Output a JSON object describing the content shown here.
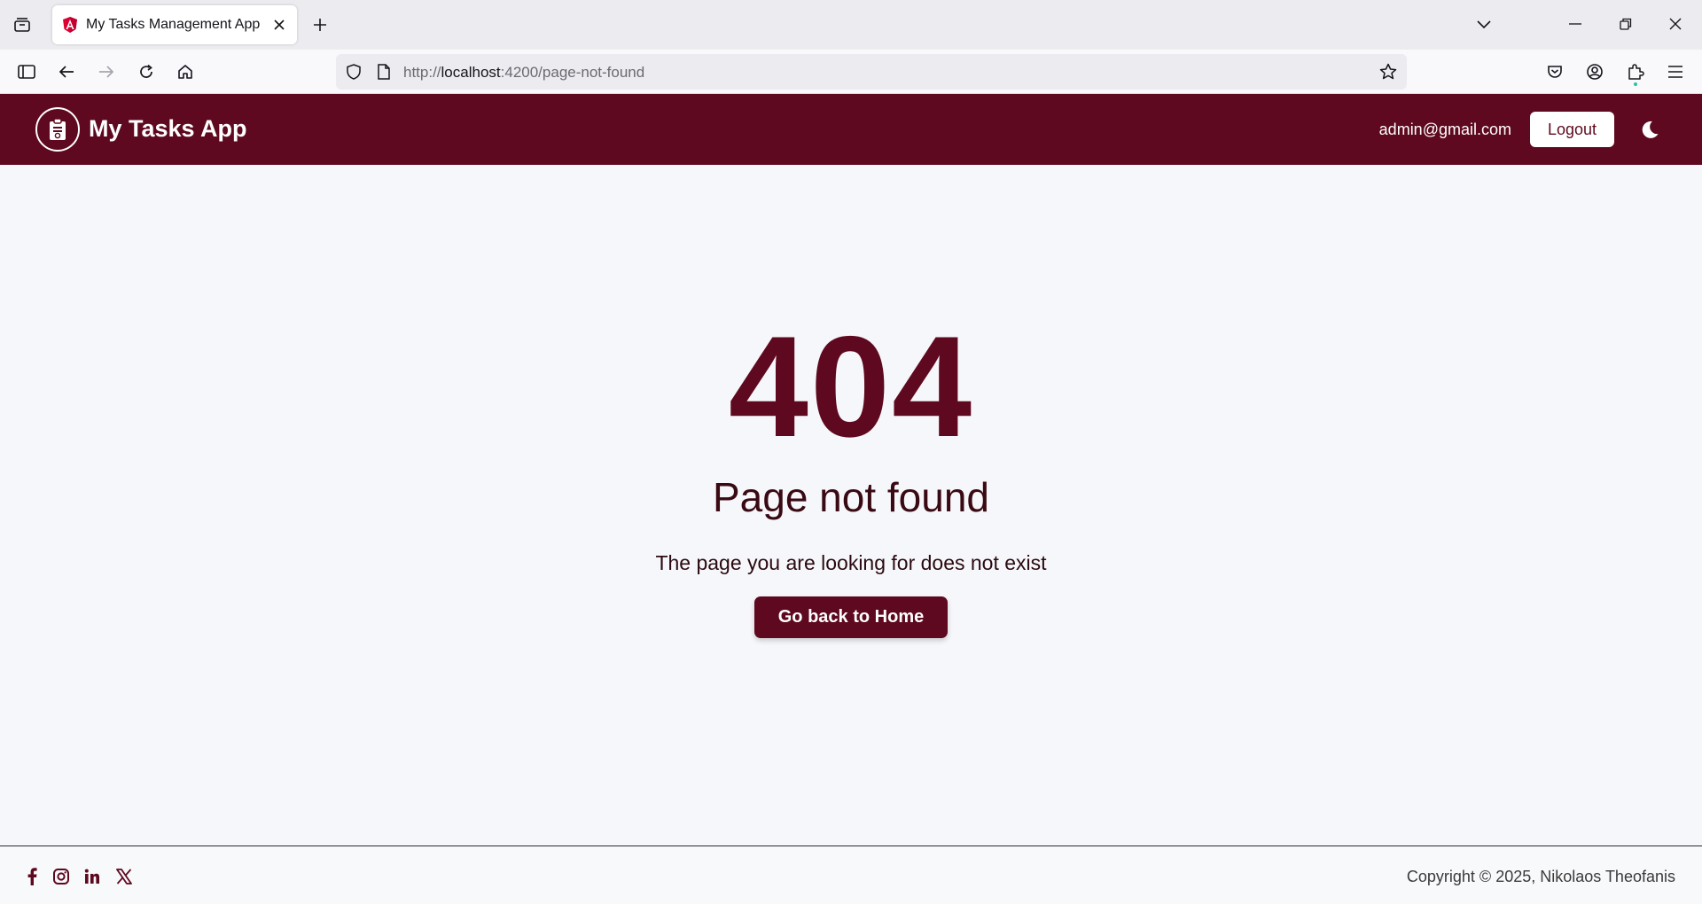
{
  "browser": {
    "tab": {
      "title": "My Tasks Management App",
      "favicon": "angular-icon"
    },
    "url": {
      "scheme": "http://",
      "host": "localhost",
      "rest": ":4200/page-not-found"
    }
  },
  "header": {
    "brand": "My Tasks App",
    "user_email": "admin@gmail.com",
    "logout_label": "Logout",
    "theme_icon": "moon-icon",
    "bg_color": "#5e091f"
  },
  "main": {
    "error_code": "404",
    "error_title": "Page not found",
    "error_text": "The page you are looking for does not exist",
    "home_button_label": "Go back to Home"
  },
  "footer": {
    "social": [
      "facebook-icon",
      "instagram-icon",
      "linkedin-icon",
      "x-icon"
    ],
    "copyright": "Copyright © 2025, Nikolaos Theofanis"
  },
  "colors": {
    "accent": "#5e091f",
    "background": "#f6f7fa"
  }
}
